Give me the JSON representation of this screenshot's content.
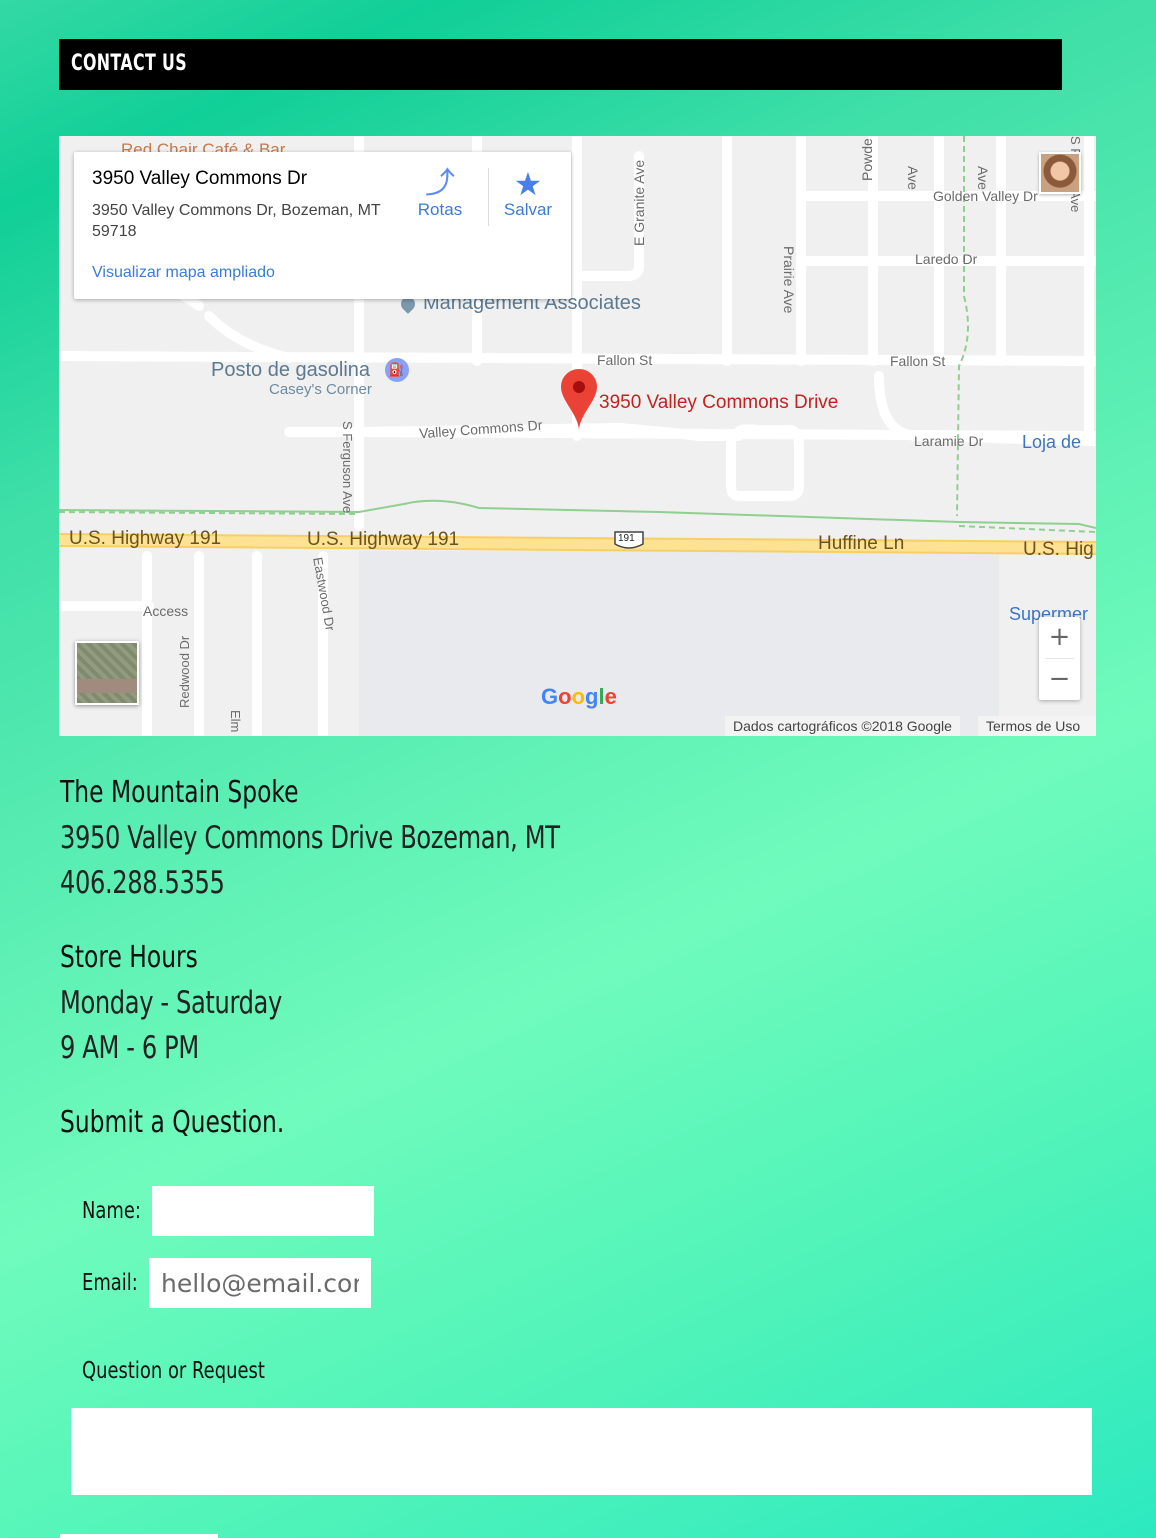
{
  "header": {
    "title": "CONTACT US"
  },
  "map": {
    "info_card": {
      "title": "3950 Valley Commons Dr",
      "address": "3950 Valley Commons Dr, Bozeman, MT 59718",
      "directions_label": "Rotas",
      "save_label": "Salvar",
      "larger_map_link": "Visualizar mapa ampliado"
    },
    "pin_label": "3950 Valley Commons Drive",
    "labels": {
      "red_chair": "Red Chair Café & Bar",
      "management": "Management Associates",
      "gas_station": "Posto de gasolina",
      "gas_sub": "Casey's Corner",
      "fallon_st_1": "Fallon St",
      "fallon_st_2": "Fallon St",
      "valley_commons_dr": "Valley Commons Dr",
      "laramie_dr": "Laramie Dr",
      "loja": "Loja de",
      "golden_valley": "Golden Valley Dr",
      "laredo": "Laredo Dr",
      "granite": "E Granite Ave",
      "prairie": "Prairie Ave",
      "powder": "Powde",
      "ave_1": "Ave",
      "ave_2": "Ave",
      "fowler": "S Fowler Ave",
      "ferguson": "S Ferguson Ave",
      "eastwood": "Eastwood Dr",
      "redwood": "Redwood Dr",
      "elm": "Elm",
      "access": "Access",
      "hwy_1": "U.S. Highway 191",
      "hwy_2": "U.S. Highway 191",
      "hwy_shield": "191",
      "huffine": "Huffine Ln",
      "hwy_3": "U.S. Hig",
      "supermer": "Supermer"
    },
    "zoom_in": "+",
    "zoom_out": "−",
    "google_logo": "Google",
    "attribution": "Dados cartográficos ©2018 Google",
    "terms": "Termos de Uso"
  },
  "store": {
    "name": "The Mountain Spoke",
    "address": "3950 Valley Commons Drive Bozeman, MT",
    "phone": "406.288.5355"
  },
  "hours": {
    "heading": "Store Hours",
    "days": "Monday - Saturday",
    "time": "9 AM - 6 PM"
  },
  "form": {
    "heading": "Submit a Question.",
    "name_label": "Name:",
    "name_value": "",
    "email_label": "Email:",
    "email_placeholder": "hello@email.com",
    "question_label": "Question or Request",
    "question_value": ""
  },
  "colors": {
    "accent_blue": "#3b7cd6",
    "pin_red": "#ea4335",
    "header_bg": "#000000"
  }
}
